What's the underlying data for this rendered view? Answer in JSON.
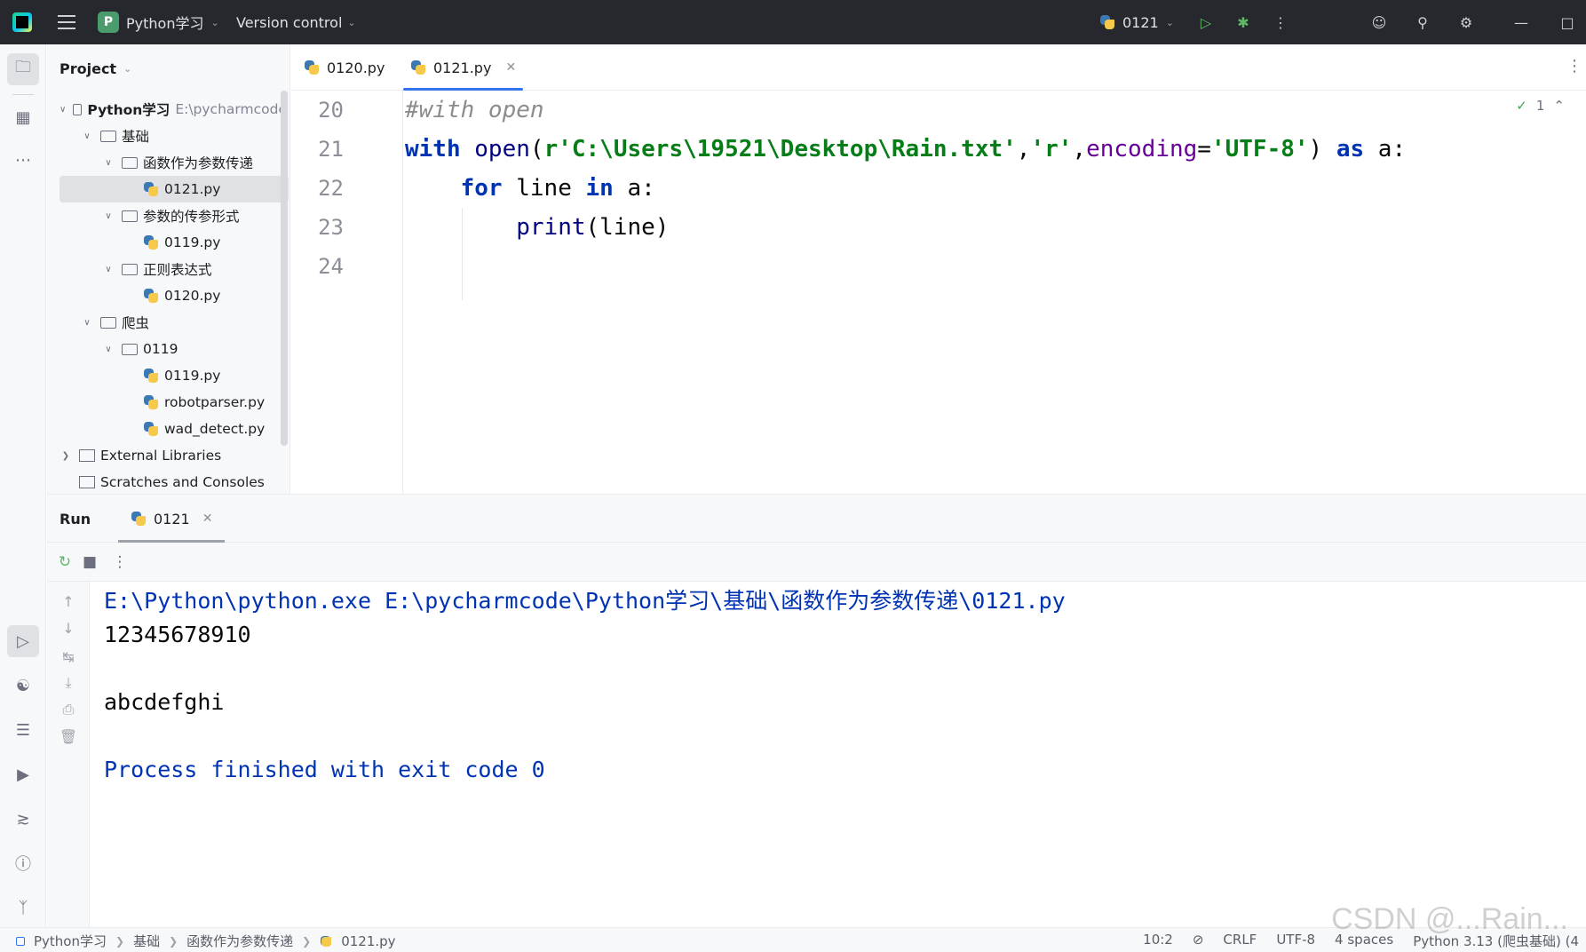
{
  "titlebar": {
    "project_badge": "P",
    "project_name": "Python学习",
    "version_control": "Version control",
    "run_config": "0121"
  },
  "project_panel": {
    "title": "Project",
    "tree": [
      {
        "label": "Python学习",
        "hint": "E:\\pycharmcode",
        "type": "folder",
        "expanded": true,
        "bold": true
      },
      {
        "label": "基础",
        "type": "folder",
        "expanded": true
      },
      {
        "label": "函数作为参数传递",
        "type": "folder",
        "expanded": true
      },
      {
        "label": "0121.py",
        "type": "python",
        "selected": true
      },
      {
        "label": "参数的传参形式",
        "type": "folder",
        "expanded": true
      },
      {
        "label": "0119.py",
        "type": "python"
      },
      {
        "label": "正则表达式",
        "type": "folder",
        "expanded": true
      },
      {
        "label": "0120.py",
        "type": "python"
      },
      {
        "label": "爬虫",
        "type": "folder",
        "expanded": true
      },
      {
        "label": "0119",
        "type": "folder",
        "expanded": true
      },
      {
        "label": "0119.py",
        "type": "python"
      },
      {
        "label": "robotparser.py",
        "type": "python"
      },
      {
        "label": "wad_detect.py",
        "type": "python"
      },
      {
        "label": "External Libraries",
        "type": "library",
        "expanded": false
      },
      {
        "label": "Scratches and Consoles",
        "type": "scratch"
      }
    ]
  },
  "editor_tabs": [
    {
      "label": "0120.py",
      "active": false
    },
    {
      "label": "0121.py",
      "active": true
    }
  ],
  "editor": {
    "inspection_count": "1",
    "line_numbers": [
      "20",
      "21",
      "22",
      "23",
      "24"
    ]
  },
  "run_window": {
    "title": "Run",
    "tab_label": "0121",
    "console": [
      {
        "text": "E:\\Python\\python.exe E:\\pycharmcode\\Python学习\\基础\\函数作为参数传递\\0121.py",
        "kind": "sys"
      },
      {
        "text": "12345678910",
        "kind": "out"
      },
      {
        "text": "",
        "kind": "out"
      },
      {
        "text": "abcdefghi",
        "kind": "out"
      },
      {
        "text": "",
        "kind": "out"
      },
      {
        "text": "Process finished with exit code 0",
        "kind": "sys"
      }
    ]
  },
  "statusbar": {
    "breadcrumbs": [
      "Python学习",
      "基础",
      "函数作为参数传递",
      "0121.py"
    ],
    "position": "10:2",
    "line_ending": "CRLF",
    "encoding": "UTF-8",
    "indent": "4 spaces",
    "interpreter": "Python 3.13 (爬虫基础) (4"
  },
  "watermark": "CSDN @...Rain...",
  "colors": {
    "accent": "#3574f0",
    "keyword": "#0033b3",
    "string": "#067d17",
    "comment": "#8c8c8c",
    "param": "#660099",
    "run_green": "#5fb865"
  }
}
